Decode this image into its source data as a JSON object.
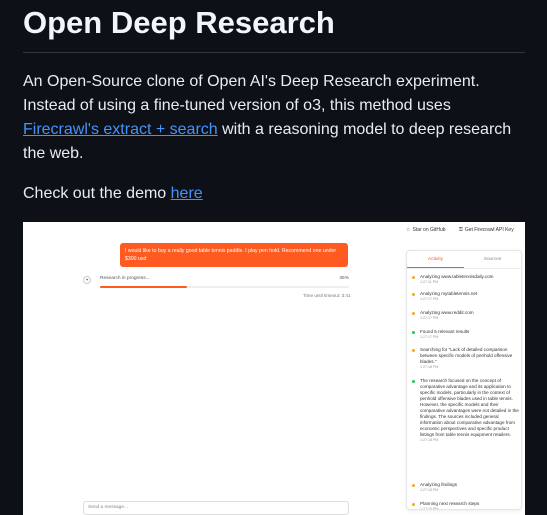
{
  "readme": {
    "title": "Open Deep Research",
    "desc_part1": "An Open-Source clone of Open AI's Deep Research experiment. Instead of using a fine-tuned version of o3, this method uses ",
    "desc_link": "Firecrawl's extract + search",
    "desc_part2": " with a reasoning model to deep research the web.",
    "demo_text": "Check out the demo ",
    "demo_link": "here"
  },
  "app": {
    "star_label": "Star on GitHub",
    "api_key_label": "Get Firecrawl API Key",
    "user_message": "I would like to buy a really good table tennis paddle. I play pen hold. Recommend one under $300 usd",
    "progress_label": "Research in progress...",
    "progress_pct": "35%",
    "progress_value": 0.35,
    "time_left": "Time until timeout: 3:41",
    "input_placeholder": "Send a message...",
    "tabs": [
      "Activity",
      "Sources"
    ],
    "activity": [
      {
        "text": "Analyzing www.tabletennisdaily.com",
        "time": "1:27:11 PM",
        "color": "#f5a623"
      },
      {
        "text": "Analyzing mytabletennis.net",
        "time": "1:27:17 PM",
        "color": "#f5a623"
      },
      {
        "text": "Analyzing www.reddit.com",
        "time": "1:27:17 PM",
        "color": "#f5a623"
      },
      {
        "text": "Found 5 relevant results",
        "time": "1:27:17 PM",
        "color": "#22c55e"
      },
      {
        "text": "Searching for \"Lack of detailed comparison between specific models of penhold offensive blades.\"",
        "time": "1:27:18 PM",
        "color": "#f5a623"
      },
      {
        "text": "The research focused on the concept of comparative advantage and its application to specific models, particularly in the context of penhold offensive blades used in table tennis. However, the specific models and their comparative advantages were not detailed in the findings. The sources included general information about comparative advantage from economic perspectives and specific product listings from table tennis equipment retailers.",
        "time": "1:27:18 PM",
        "color": "#22c55e"
      },
      {
        "text": "Analyzing findings",
        "time": "1:27:18 PM",
        "color": "#f5a623"
      },
      {
        "text": "Planning next research steps",
        "time": "1:27:18 PM",
        "color": "#f5a623"
      }
    ],
    "accent": "#ff5a1f"
  }
}
